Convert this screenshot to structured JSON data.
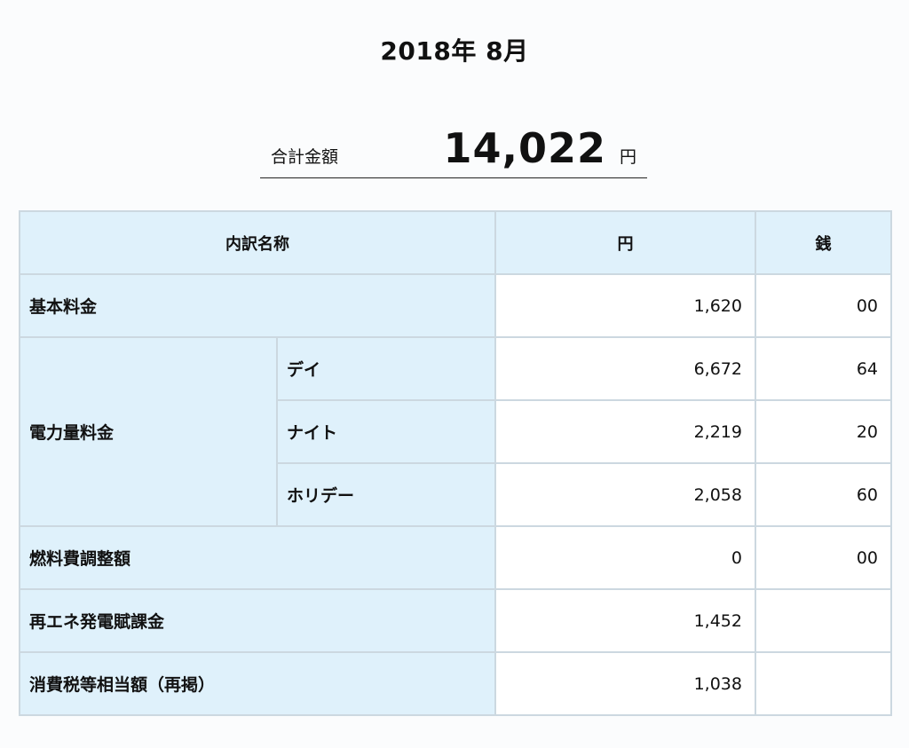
{
  "header": {
    "period": "2018年 8月"
  },
  "total": {
    "label": "合計金額",
    "amount": "14,022",
    "unit": "円"
  },
  "table": {
    "columns": {
      "name": "内訳名称",
      "yen": "円",
      "sen": "銭"
    },
    "rows": {
      "basic": {
        "label": "基本料金",
        "yen": "1,620",
        "sen": "00"
      },
      "energy": {
        "label": "電力量料金",
        "day": {
          "label": "デイ",
          "yen": "6,672",
          "sen": "64"
        },
        "night": {
          "label": "ナイト",
          "yen": "2,219",
          "sen": "20"
        },
        "holiday": {
          "label": "ホリデー",
          "yen": "2,058",
          "sen": "60"
        }
      },
      "fuel": {
        "label": "燃料費調整額",
        "yen": "0",
        "sen": "00"
      },
      "renewable": {
        "label": "再エネ発電賦課金",
        "yen": "1,452",
        "sen": ""
      },
      "tax": {
        "label": "消費税等相当額（再掲）",
        "yen": "1,038",
        "sen": ""
      }
    }
  }
}
